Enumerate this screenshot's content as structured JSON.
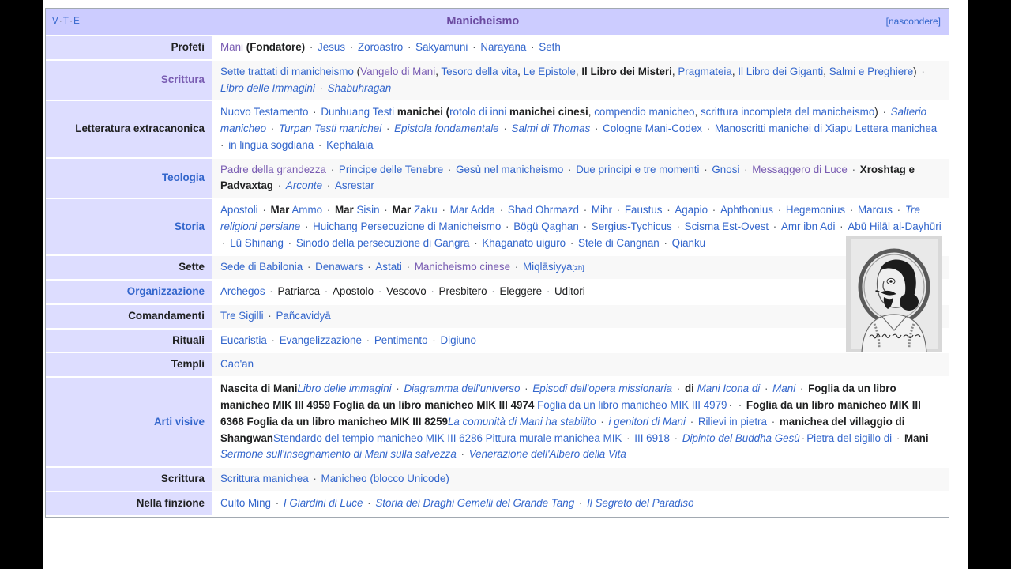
{
  "navbox": {
    "vte": {
      "v": "V",
      "t": "T",
      "e": "E",
      "sep": "·"
    },
    "title": "Manicheismo",
    "hide_label": "[nascondere]",
    "colors": {
      "title_bar_bg": "#ccccff",
      "label_bg": "#ddddff",
      "link": "#3366cc",
      "visited_link": "#795cb2",
      "row_alt_bg": "#f8f8f8",
      "border": "#a2a9b1"
    },
    "image": {
      "alt": "Ritratto di Mani con aureola",
      "caption_script": "manuscript inscription"
    },
    "rows": [
      {
        "label": "Profeti",
        "label_style": "plain",
        "alt": false,
        "items": [
          {
            "text": "Mani",
            "style": "visited"
          },
          {
            "text": " (Fondatore)",
            "style": "bold-plain",
            "nodot": true
          },
          {
            "text": "Jesus",
            "style": "link"
          },
          {
            "text": "Zoroastro",
            "style": "link"
          },
          {
            "text": "Sakyamuni",
            "style": "link"
          },
          {
            "text": "Narayana",
            "style": "link"
          },
          {
            "text": "Seth",
            "style": "link"
          }
        ]
      },
      {
        "label": "Scrittura",
        "label_style": "visited",
        "alt": true,
        "items": [
          {
            "text": "Sette trattati di manicheismo",
            "style": "link"
          },
          {
            "text": " (",
            "style": "plain",
            "nodot": true
          },
          {
            "text": "Vangelo di Mani",
            "style": "visited",
            "nodot": true
          },
          {
            "text": ", ",
            "style": "plain",
            "nodot": true
          },
          {
            "text": "Tesoro della vita",
            "style": "link",
            "nodot": true
          },
          {
            "text": ", ",
            "style": "plain",
            "nodot": true
          },
          {
            "text": "Le Epistole",
            "style": "link",
            "nodot": true
          },
          {
            "text": ", ",
            "style": "plain",
            "nodot": true
          },
          {
            "text": "Il Libro dei Misteri",
            "style": "bold-plain",
            "nodot": true
          },
          {
            "text": ", ",
            "style": "plain",
            "nodot": true
          },
          {
            "text": "Pragmateia",
            "style": "link",
            "nodot": true
          },
          {
            "text": ", ",
            "style": "plain",
            "nodot": true
          },
          {
            "text": "Il Libro dei Giganti",
            "style": "link",
            "nodot": true
          },
          {
            "text": ", ",
            "style": "plain",
            "nodot": true
          },
          {
            "text": "Salmi e Preghiere",
            "style": "link",
            "nodot": true
          },
          {
            "text": ")",
            "style": "plain",
            "nodot": true
          },
          {
            "text": "Libro delle Immagini",
            "style": "link-italic"
          },
          {
            "text": "Shabuhragan",
            "style": "link-italic"
          }
        ]
      },
      {
        "label": "Letteratura extracanonica",
        "label_style": "plain",
        "alt": false,
        "items": [
          {
            "text": "Nuovo Testamento",
            "style": "link"
          },
          {
            "text": "Dunhuang Testi",
            "style": "link"
          },
          {
            "text": " manichei (",
            "style": "bold-plain",
            "nodot": true
          },
          {
            "text": "rotolo di inni",
            "style": "link",
            "nodot": true
          },
          {
            "text": " manichei cinesi",
            "style": "bold-plain",
            "nodot": true
          },
          {
            "text": ", ",
            "style": "plain",
            "nodot": true
          },
          {
            "text": "compendio manicheo",
            "style": "link",
            "nodot": true
          },
          {
            "text": ", ",
            "style": "plain",
            "nodot": true
          },
          {
            "text": "scrittura incompleta del manicheismo",
            "style": "link",
            "nodot": true
          },
          {
            "text": ")",
            "style": "plain",
            "nodot": true
          },
          {
            "text": "Salterio manicheo",
            "style": "link-italic"
          },
          {
            "text": "Turpan Testi manichei",
            "style": "link-italic"
          },
          {
            "text": "Epistola fondamentale",
            "style": "link-italic"
          },
          {
            "text": "Salmi di Thomas",
            "style": "link-italic"
          },
          {
            "text": "Cologne Mani-Codex",
            "style": "link"
          },
          {
            "text": "Manoscritti manichei di Xiapu Lettera manichea",
            "style": "link"
          },
          {
            "text": "in lingua sogdiana",
            "style": "link"
          },
          {
            "text": "Kephalaia",
            "style": "link"
          }
        ]
      },
      {
        "label": "Teologia",
        "label_style": "link",
        "alt": true,
        "items": [
          {
            "text": "Padre della grandezza",
            "style": "visited"
          },
          {
            "text": "Principe delle Tenebre",
            "style": "link"
          },
          {
            "text": "Gesù nel manicheismo",
            "style": "link"
          },
          {
            "text": "Due principi e tre momenti",
            "style": "link"
          },
          {
            "text": "Gnosi",
            "style": "link"
          },
          {
            "text": "Messaggero di Luce",
            "style": "visited"
          },
          {
            "text": "Xroshtag e Padvaxtag",
            "style": "bold-plain"
          },
          {
            "text": "Arconte",
            "style": "link-italic"
          },
          {
            "text": "Asrestar",
            "style": "link"
          }
        ]
      },
      {
        "label": "Storia",
        "label_style": "link",
        "alt": false,
        "items": [
          {
            "text": "Apostoli",
            "style": "link"
          },
          {
            "text": "Mar",
            "style": "bold-plain"
          },
          {
            "text": " Ammo",
            "style": "link",
            "nodot": true
          },
          {
            "text": "Mar",
            "style": "bold-plain"
          },
          {
            "text": " Sisin",
            "style": "link",
            "nodot": true
          },
          {
            "text": "Mar",
            "style": "bold-plain"
          },
          {
            "text": " Zaku",
            "style": "link",
            "nodot": true
          },
          {
            "text": "Mar Adda",
            "style": "link"
          },
          {
            "text": "Shad Ohrmazd",
            "style": "link"
          },
          {
            "text": "Mihr",
            "style": "link"
          },
          {
            "text": "Faustus",
            "style": "link"
          },
          {
            "text": "Agapio",
            "style": "link"
          },
          {
            "text": "Aphthonius",
            "style": "link"
          },
          {
            "text": "Hegemonius",
            "style": "link"
          },
          {
            "text": "Marcus",
            "style": "link"
          },
          {
            "text": "Tre religioni persiane",
            "style": "link-italic"
          },
          {
            "text": "Huichang Persecuzione di Manicheismo",
            "style": "link"
          },
          {
            "text": "Bögü Qaghan",
            "style": "link"
          },
          {
            "text": "Sergius-Tychicus",
            "style": "link"
          },
          {
            "text": "Scisma Est-Ovest",
            "style": "link"
          },
          {
            "text": "Amr ibn Adi",
            "style": "link"
          },
          {
            "text": "Abū Hilāl al-Dayhūri",
            "style": "link"
          },
          {
            "text": "Lü Shinang",
            "style": "link"
          },
          {
            "text": "Sinodo della persecuzione di Gangra",
            "style": "link"
          },
          {
            "text": "Khaganato uiguro",
            "style": "link"
          },
          {
            "text": "Stele di Cangnan",
            "style": "link"
          },
          {
            "text": "Qianku",
            "style": "link"
          }
        ]
      },
      {
        "label": "Sette",
        "label_style": "plain",
        "alt": true,
        "items": [
          {
            "text": "Sede di Babilonia",
            "style": "link"
          },
          {
            "text": "Denawars",
            "style": "link"
          },
          {
            "text": "Astati",
            "style": "link"
          },
          {
            "text": "Manicheismo cinese",
            "style": "visited"
          },
          {
            "text": "Miqlāsiyya",
            "style": "link"
          },
          {
            "text": "[zh]",
            "style": "sup",
            "nodot": true
          }
        ]
      },
      {
        "label": "Organizzazione",
        "label_style": "link",
        "alt": false,
        "items": [
          {
            "text": "Archegos",
            "style": "link"
          },
          {
            "text": "Patriarca",
            "style": "plain"
          },
          {
            "text": "Apostolo",
            "style": "plain"
          },
          {
            "text": "Vescovo",
            "style": "plain"
          },
          {
            "text": "Presbitero",
            "style": "plain"
          },
          {
            "text": "Eleggere",
            "style": "plain"
          },
          {
            "text": "Uditori",
            "style": "plain"
          }
        ]
      },
      {
        "label": "Comandamenti",
        "label_style": "plain",
        "alt": true,
        "items": [
          {
            "text": "Tre Sigilli",
            "style": "link"
          },
          {
            "text": "Pañcavidyā",
            "style": "link"
          }
        ]
      },
      {
        "label": "Rituali",
        "label_style": "plain",
        "alt": false,
        "items": [
          {
            "text": "Eucaristia",
            "style": "link"
          },
          {
            "text": "Evangelizzazione",
            "style": "link"
          },
          {
            "text": "Pentimento",
            "style": "link"
          },
          {
            "text": "Digiuno",
            "style": "link"
          }
        ]
      },
      {
        "label": "Templi",
        "label_style": "plain",
        "alt": true,
        "items": [
          {
            "text": "Cao'an",
            "style": "link"
          }
        ]
      },
      {
        "label": "Arti visive",
        "label_style": "link",
        "alt": false,
        "items": [
          {
            "text": "Nascita di Mani",
            "style": "bold-plain",
            "nodot": true
          },
          {
            "text": "Libro delle immagini",
            "style": "link-italic",
            "nodot": true
          },
          {
            "text": "Diagramma dell'universo",
            "style": "link-italic"
          },
          {
            "text": "Episodi dell'opera missionaria",
            "style": "link-italic"
          },
          {
            "text": "di",
            "style": "bold-plain"
          },
          {
            "text": " Mani Icona di",
            "style": "link-italic",
            "nodot": true
          },
          {
            "text": "Mani",
            "style": "link-italic"
          },
          {
            "text": "Foglia da un libro manicheo MIK III 4959 Foglia da un libro manicheo MIK III 4974",
            "style": "bold-plain"
          },
          {
            "text": " Foglia da un libro manicheo MIK III 4979",
            "style": "link",
            "nodot": true
          },
          {
            "text": "·",
            "style": "dotonly"
          },
          {
            "text": "Foglia da un libro manicheo MIK III 6368 Foglia da un libro manicheo MIK III 8259",
            "style": "bold-plain"
          },
          {
            "text": "La comunità di Mani ha stabilito",
            "style": "link-italic",
            "nodot": true
          },
          {
            "text": "i genitori di Mani",
            "style": "link-italic"
          },
          {
            "text": "Rilievi in pietra",
            "style": "link"
          },
          {
            "text": "manichea del villaggio di Shangwan",
            "style": "bold-plain"
          },
          {
            "text": "Stendardo del tempio manicheo MIK III 6286 Pittura murale manichea MIK",
            "style": "link",
            "nodot": true
          },
          {
            "text": "III 6918",
            "style": "link"
          },
          {
            "text": "Dipinto del Buddha Gesù",
            "style": "link-italic"
          },
          {
            "text": "·",
            "style": "dotonly"
          },
          {
            "text": "Pietra del sigillo di",
            "style": "link",
            "nodot": true
          },
          {
            "text": "Mani",
            "style": "bold-plain"
          },
          {
            "text": " Sermone sull'insegnamento di Mani sulla salvezza",
            "style": "link-italic",
            "nodot": true
          },
          {
            "text": "Venerazione dell'Albero della Vita",
            "style": "link-italic"
          }
        ]
      },
      {
        "label": "Scrittura",
        "label_style": "plain",
        "alt": true,
        "items": [
          {
            "text": "Scrittura manichea",
            "style": "link"
          },
          {
            "text": "Manicheo (blocco Unicode)",
            "style": "link"
          }
        ]
      },
      {
        "label": "Nella finzione",
        "label_style": "plain",
        "alt": false,
        "items": [
          {
            "text": "Culto Ming",
            "style": "link"
          },
          {
            "text": "I Giardini di Luce",
            "style": "link-italic"
          },
          {
            "text": "Storia dei Draghi Gemelli del Grande Tang",
            "style": "link-italic"
          },
          {
            "text": "Il Segreto del Paradiso",
            "style": "link-italic"
          }
        ]
      }
    ]
  }
}
